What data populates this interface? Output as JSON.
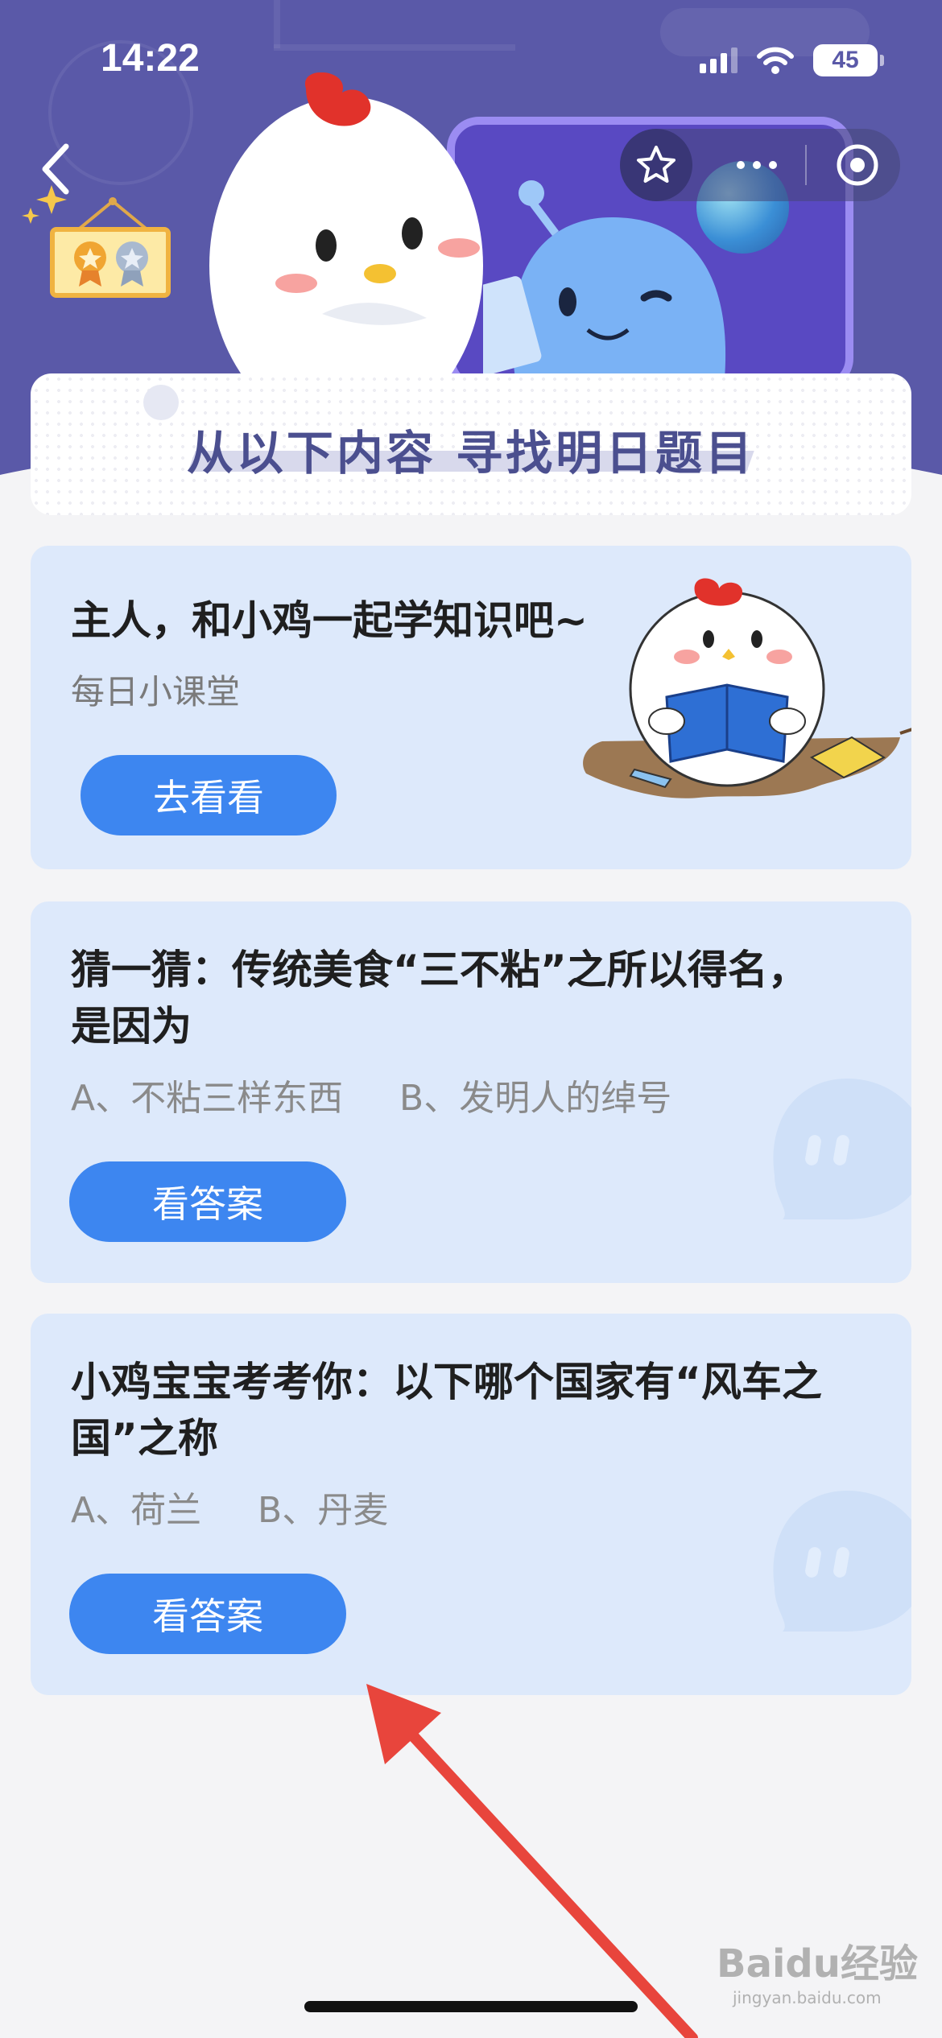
{
  "status_bar": {
    "time": "14:22",
    "battery": "45"
  },
  "banner": {
    "title": "从以下内容  寻找明日题目"
  },
  "cards": [
    {
      "title": "主人，和小鸡一起学知识吧~",
      "subtitle": "每日小课堂",
      "button": "去看看"
    },
    {
      "title": "猜一猜：传统美食“三不粘”之所以得名，是因为",
      "options": "A、不粘三样东西     B、发明人的绰号",
      "button": "看答案"
    },
    {
      "title": "小鸡宝宝考考你：以下哪个国家有“风车之国”之称",
      "options": "A、荷兰     B、丹麦",
      "button": "看答案"
    }
  ],
  "watermark": {
    "text": "Baidu经验",
    "sub": "jingyan.baidu.com"
  },
  "colors": {
    "header": "#5a59a8",
    "card": "#dde9fb",
    "button": "#3d86f0",
    "arrow": "#e8453c"
  },
  "icons": [
    "back-arrow-icon",
    "badge-board-icon",
    "star-icon",
    "more-dots-icon",
    "target-circle-icon",
    "chat-bubble-icon"
  ]
}
